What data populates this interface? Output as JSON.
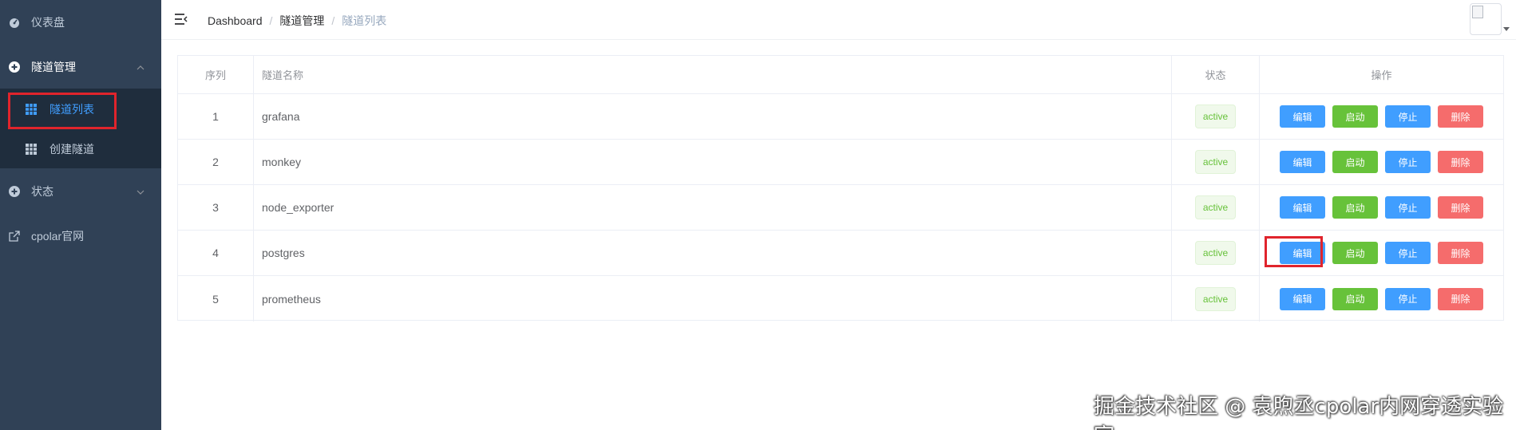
{
  "sidebar": {
    "items": [
      {
        "label": "仪表盘",
        "icon": "dashboard-icon"
      },
      {
        "label": "隧道管理",
        "icon": "plus-circle-icon"
      },
      {
        "label": "状态",
        "icon": "plus-circle-icon"
      },
      {
        "label": "cpolar官网",
        "icon": "external-link-icon"
      }
    ],
    "submenu": [
      {
        "label": "隧道列表",
        "icon": "table-icon",
        "active": true
      },
      {
        "label": "创建隧道",
        "icon": "table-icon",
        "active": false
      }
    ]
  },
  "header": {
    "breadcrumb": [
      "Dashboard",
      "隧道管理",
      "隧道列表"
    ],
    "separator": "/"
  },
  "table": {
    "columns": [
      "序列",
      "隧道名称",
      "状态",
      "操作"
    ],
    "rows": [
      {
        "index": "1",
        "name": "grafana",
        "status": "active"
      },
      {
        "index": "2",
        "name": "monkey",
        "status": "active"
      },
      {
        "index": "3",
        "name": "node_exporter",
        "status": "active"
      },
      {
        "index": "4",
        "name": "postgres",
        "status": "active"
      },
      {
        "index": "5",
        "name": "prometheus",
        "status": "active"
      }
    ],
    "actions": {
      "edit": "编辑",
      "start": "启动",
      "stop": "停止",
      "delete": "删除"
    }
  },
  "colors": {
    "sidebar_bg": "#304156",
    "submenu_bg": "#1f2d3d",
    "accent": "#409eff",
    "success": "#67c23a",
    "danger": "#f56c6c",
    "highlight": "#e0242c"
  },
  "watermark": "掘金技术社区 @ 袁煦丞cpolar内网穿透实验室"
}
